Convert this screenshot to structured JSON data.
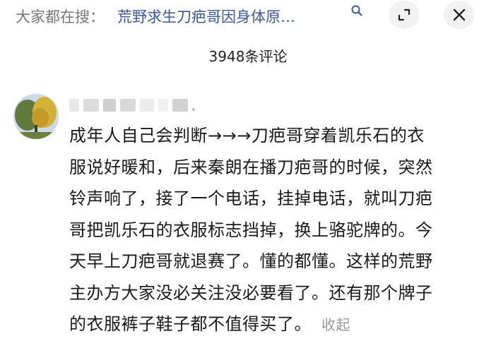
{
  "header": {
    "search_prefix": "大家都在搜：",
    "search_query": "荒野求生刀疤哥因身体原…",
    "search_icon": "search-icon",
    "expand_icon": "expand-icon",
    "close_icon": "close-icon"
  },
  "comments_count": "3948条评论",
  "comment": {
    "lines": [
      "成年人自己会判断→→→刀疤哥穿着凯乐石的衣",
      "服说好暖和，后来秦朗在播刀疤哥的时候，突然",
      "铃声响了，接了一个电话，挂掉电话，就叫刀疤",
      "哥把凯乐石的衣服标志挡掉，换上骆驼牌的。今",
      "天早上刀疤哥就退赛了。懂的都懂。这样的荒野",
      "主办方大家没必关注没必要看了。还有那个牌子",
      "的衣服裤子鞋子都不值得买了。"
    ],
    "collapse_label": "收起"
  }
}
